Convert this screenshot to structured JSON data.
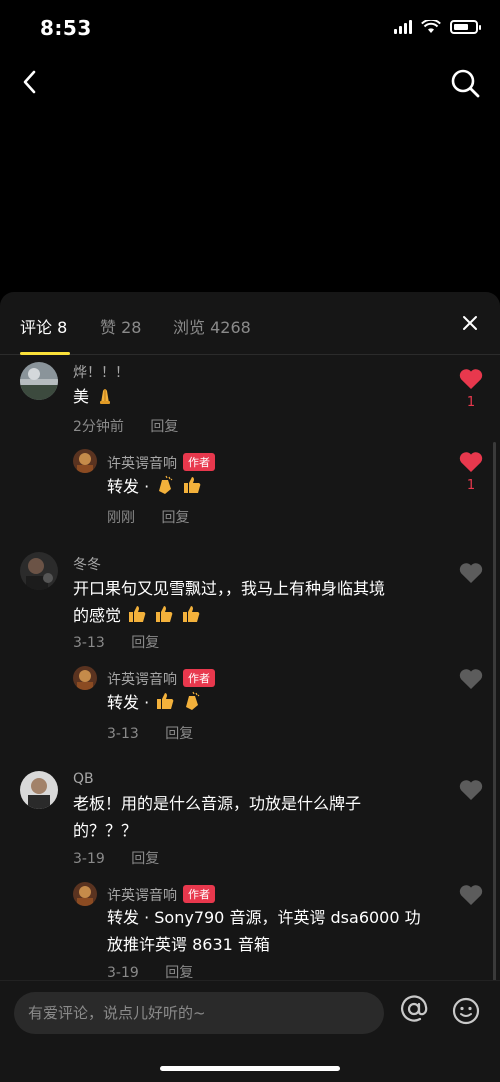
{
  "status": {
    "time": "8:53"
  },
  "tabs": [
    {
      "label": "评论 8"
    },
    {
      "label": "赞 28"
    },
    {
      "label": "浏览 4268"
    }
  ],
  "comments": [
    {
      "name": "烨！！！",
      "text": "美",
      "time": "2分钟前",
      "reply": "回复",
      "likes": "1",
      "liked": true,
      "replies": [
        {
          "name": "许英谔音响",
          "badge": "作者",
          "text": "转发 ·",
          "time": "刚刚",
          "reply": "回复",
          "likes": "1",
          "liked": true
        }
      ]
    },
    {
      "name": "冬冬",
      "text_line1": "开口果句又见雪飘过，，我马上有种身临其境",
      "text_line2": "的感觉",
      "time": "3-13",
      "reply": "回复",
      "replies": [
        {
          "name": "许英谔音响",
          "badge": "作者",
          "text": "转发 ·",
          "time": "3-13",
          "reply": "回复"
        }
      ]
    },
    {
      "name": "QB",
      "text_line1": "老板！用的是什么音源，功放是什么牌子",
      "text_line2": "的？？？",
      "time": "3-19",
      "reply": "回复",
      "replies": [
        {
          "name": "许英谔音响",
          "badge": "作者",
          "text_line1": "转发 · Sony790 音源，许英谔 dsa6000 功",
          "text_line2": "放推许英谔 8631 音箱",
          "time": "3-19",
          "reply": "回复"
        }
      ]
    }
  ],
  "input": {
    "placeholder": "有爱评论，说点儿好听的~"
  },
  "icons": {
    "back": "chevron-left-icon",
    "search": "search-icon",
    "close": "close-icon",
    "like": "heart-icon",
    "at": "at-icon",
    "emoji": "smiley-icon"
  },
  "colors": {
    "accent_tab": "#fbe13a",
    "like_red": "#e8384d",
    "author_badge": "#e8384d"
  }
}
